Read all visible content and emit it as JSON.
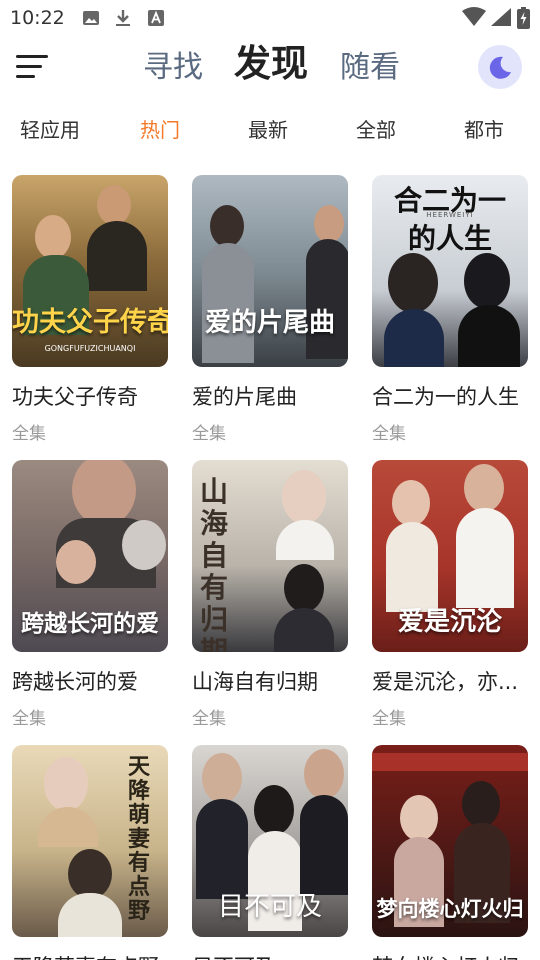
{
  "status_bar": {
    "time": "10:22"
  },
  "header": {
    "tabs": [
      {
        "label": "寻找",
        "active": false
      },
      {
        "label": "发现",
        "active": true
      },
      {
        "label": "随看",
        "active": false
      }
    ]
  },
  "categories": [
    "轻应用",
    "热门",
    "最新",
    "全部",
    "都市"
  ],
  "active_category": "热门",
  "colors": {
    "accent": "#f47a2a",
    "theme_button_bg": "#e2e4fb",
    "moon": "#6b66e8"
  },
  "cards": [
    {
      "title": "功夫父子传奇",
      "subtitle": "全集",
      "poster_text": "功夫父子传奇",
      "poster_caption": "GONGFUFUZICHUANQI"
    },
    {
      "title": "爱的片尾曲",
      "subtitle": "全集",
      "poster_text": "爱的片尾曲"
    },
    {
      "title": "合二为一的人生",
      "subtitle": "全集",
      "poster_text": "合二为一",
      "poster_text2": "的人生",
      "poster_caption": "HEERWEIYI"
    },
    {
      "title": "跨越长河的爱",
      "subtitle": "全集",
      "poster_text": "跨越长河的爱"
    },
    {
      "title": "山海自有归期",
      "subtitle": "全集",
      "poster_text": "山海自有归期"
    },
    {
      "title": "爱是沉沦，亦...",
      "subtitle": "全集",
      "poster_text": "爱是沉沦"
    },
    {
      "title": "天降萌妻有点野",
      "subtitle": "",
      "poster_text": "天降萌妻有点野"
    },
    {
      "title": "目不可及",
      "subtitle": "",
      "poster_text": "目不可及"
    },
    {
      "title": "梦向楼心灯火归",
      "subtitle": "",
      "poster_text": "梦向楼心灯火归"
    }
  ]
}
